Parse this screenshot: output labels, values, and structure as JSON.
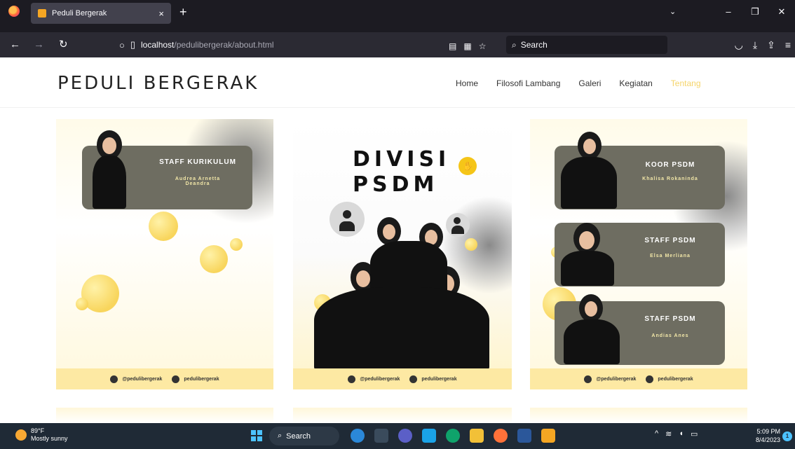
{
  "browser": {
    "tab_title": "Peduli Bergerak",
    "tab_close": "×",
    "new_tab": "+",
    "url_host": "localhost",
    "url_path": "/pedulibergerak/about.html",
    "search_placeholder": "Search",
    "icons": {
      "back": "←",
      "forward": "→",
      "reload": "↻",
      "reader": "▤",
      "bookmark": "☆",
      "search": "⌕",
      "pocket": "◡",
      "download": "⤓",
      "extensions": "⇪",
      "menu": "≡",
      "tab_list": "⌄",
      "minimize": "–",
      "restore": "❐",
      "close": "✕"
    }
  },
  "site": {
    "brand": "PEDULI BERGERAK",
    "nav": [
      {
        "label": "Home"
      },
      {
        "label": "Filosofi Lambang"
      },
      {
        "label": "Galeri"
      },
      {
        "label": "Kegiatan"
      },
      {
        "label": "Tentang",
        "active": true
      }
    ]
  },
  "cards": {
    "left": {
      "title": "STAFF KURIKULUM",
      "name": "Audrea Arnetta\nDeandra",
      "footer_ig": "@pedulibergerak",
      "footer_tt": "pedulibergerak"
    },
    "center": {
      "title_line1": "DIVISI",
      "title_line2": "PSDM",
      "footer_ig": "@pedulibergerak",
      "footer_tt": "pedulibergerak"
    },
    "right": {
      "items": [
        {
          "title": "KOOR PSDM",
          "name": "Khalisa Rokaninda"
        },
        {
          "title": "STAFF PSDM",
          "name": "Elsa Merliana"
        },
        {
          "title": "STAFF PSDM",
          "name": "Andias Anes"
        }
      ],
      "footer_ig": "@pedulibergerak",
      "footer_tt": "pedulibergerak"
    }
  },
  "taskbar": {
    "temp": "89°F",
    "weather": "Mostly sunny",
    "search": "Search",
    "time": "5:09 PM",
    "date": "8/4/2023",
    "notif_count": "1",
    "tray_chevron": "^"
  }
}
